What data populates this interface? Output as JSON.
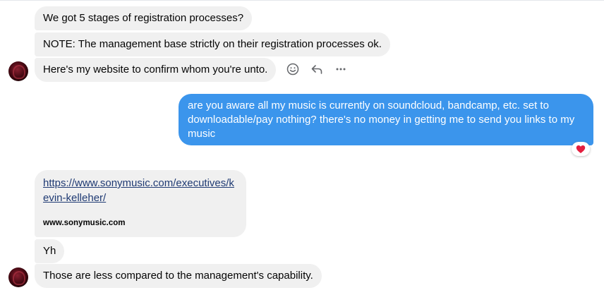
{
  "messages": {
    "m1": "We got 5 stages of registration processes?",
    "m2": "NOTE: The management base strictly on their registration processes ok.",
    "m3": "Here's my website to confirm whom you're unto.",
    "outgoing": "are you aware all my music is currently on soundcloud, bandcamp, etc. set to downloadable/pay nothing? there's no money in getting me to send you links to my music",
    "link_url": "https://www.sonymusic.com/executives/kevin-kelleher/",
    "link_domain": "www.sonymusic.com",
    "m4": "Yh",
    "m5": "Those are less compared to the management's capability."
  },
  "actions": {
    "react_icon": "smiley-icon",
    "reply_icon": "reply-arrow-icon",
    "more_icon": "more-dots-icon"
  },
  "reaction": {
    "icon": "heart-icon",
    "color": "#e41e3f"
  },
  "colors": {
    "incoming_bg": "#f0f0f0",
    "outgoing_bg": "#3b95ec"
  }
}
